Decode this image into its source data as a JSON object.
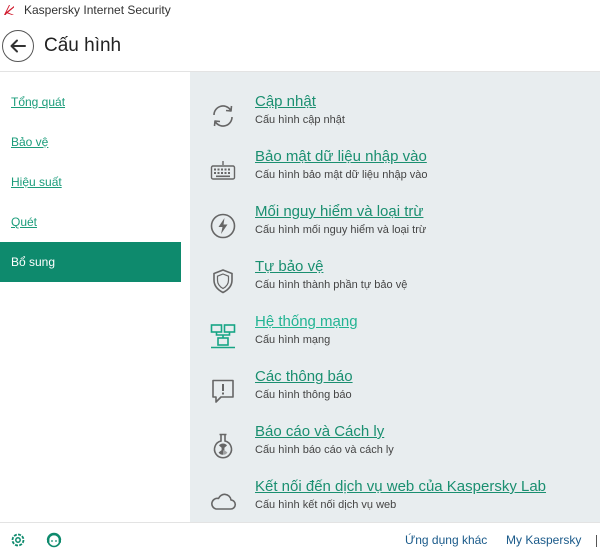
{
  "app": {
    "title": "Kaspersky Internet Security"
  },
  "header": {
    "title": "Cấu hình"
  },
  "sidebar": {
    "items": [
      {
        "label": "Tổng quát"
      },
      {
        "label": "Bảo vệ"
      },
      {
        "label": "Hiệu suất"
      },
      {
        "label": "Quét"
      },
      {
        "label": "Bổ sung",
        "active": true
      }
    ]
  },
  "content": {
    "items": [
      {
        "title": "Cập nhật",
        "subtitle": "Cấu hình cập nhật",
        "icon": "refresh-icon"
      },
      {
        "title": "Bảo mật dữ liệu nhập vào",
        "subtitle": "Cấu hình bảo mật dữ liệu nhập vào",
        "icon": "keyboard-icon"
      },
      {
        "title": "Mối nguy hiểm và loại trừ",
        "subtitle": "Cấu hình mối nguy hiểm và loại trừ",
        "icon": "lightning-icon"
      },
      {
        "title": "Tự bảo vệ",
        "subtitle": "Cấu hình thành phần tự bảo vệ",
        "icon": "shield-icon"
      },
      {
        "title": "Hệ thống mạng",
        "subtitle": "Cấu hình mạng",
        "icon": "network-icon"
      },
      {
        "title": "Các thông báo",
        "subtitle": "Cấu hình thông báo",
        "icon": "notification-icon"
      },
      {
        "title": "Báo cáo và Cách ly",
        "subtitle": "Cấu hình báo cáo và cách ly",
        "icon": "flask-icon"
      },
      {
        "title": "Kết nối đến dịch vụ web của Kaspersky Lab",
        "subtitle": "Cấu hình kết nối dịch vụ web",
        "icon": "cloud-icon"
      }
    ]
  },
  "footer": {
    "other_apps": "Ứng dụng khác",
    "my_kaspersky": "My Kaspersky"
  },
  "colors": {
    "accent": "#0e8a6d",
    "link": "#1a8f70",
    "content_bg": "#e8edef"
  }
}
